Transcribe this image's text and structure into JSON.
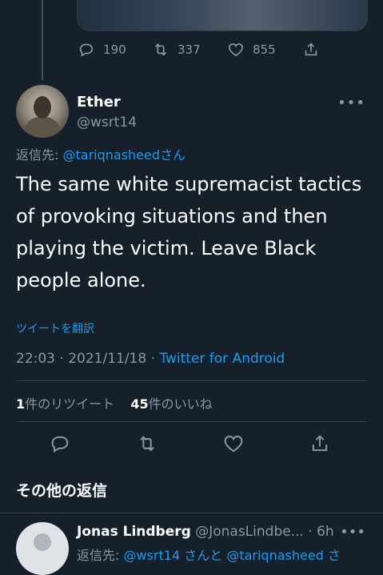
{
  "prev_tweet": {
    "reply_count": "190",
    "retweet_count": "337",
    "like_count": "855"
  },
  "tweet": {
    "display_name": "Ether",
    "handle": "@wsrt14",
    "reply_prefix": "返信先: ",
    "reply_to": "@tariqnasheed",
    "reply_suffix": "さん",
    "text": "The same white supremacist tactics of provoking situations and then playing the victim. Leave Black people alone.",
    "translate_label": "ツイートを翻訳",
    "time": "22:03 · 2021/11/18 · ",
    "source": "Twitter for Android",
    "retweets_num": "1",
    "retweets_label": "件のリツイート",
    "likes_num": "45",
    "likes_label": "件のいいね"
  },
  "section_title": "その他の返信",
  "reply_tweet": {
    "display_name": "Jonas Lindberg",
    "handle": "@JonasLindbe...",
    "time": "· 6h",
    "reply_prefix": "返信先: ",
    "reply_to_1": "@wsrt14",
    "joiner": " さんと ",
    "reply_to_2": "@tariqnasheed",
    "reply_suffix": " さ"
  },
  "colors": {
    "background": "#15202b",
    "accent": "#1d9bf0",
    "secondary": "#8899a6"
  }
}
